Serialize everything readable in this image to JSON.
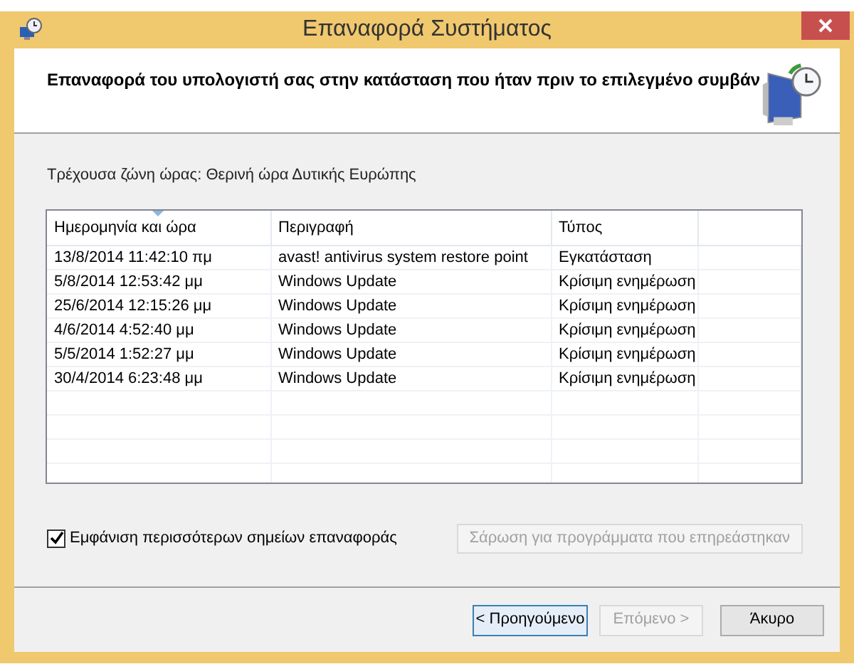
{
  "window": {
    "title": "Επαναφορά Συστήματος"
  },
  "header": {
    "text": "Επαναφορά του υπολογιστή σας στην κατάσταση που ήταν πριν το επιλεγμένο συμβάν"
  },
  "timezone": "Τρέχουσα ζώνη ώρας: Θερινή ώρα Δυτικής Ευρώπης",
  "table": {
    "columns": [
      "Ημερομηνία και ώρα",
      "Περιγραφή",
      "Τύπος"
    ],
    "rows": [
      [
        "13/8/2014 11:42:10 πμ",
        "avast! antivirus system restore point",
        "Εγκατάσταση"
      ],
      [
        "5/8/2014 12:53:42 μμ",
        "Windows Update",
        "Κρίσιμη ενημέρωση"
      ],
      [
        "25/6/2014 12:15:26 μμ",
        "Windows Update",
        "Κρίσιμη ενημέρωση"
      ],
      [
        "4/6/2014 4:52:40 μμ",
        "Windows Update",
        "Κρίσιμη ενημέρωση"
      ],
      [
        "5/5/2014 1:52:27 μμ",
        "Windows Update",
        "Κρίσιμη ενημέρωση"
      ],
      [
        "30/4/2014 6:23:48 μμ",
        "Windows Update",
        "Κρίσιμη ενημέρωση"
      ]
    ]
  },
  "show_more": {
    "label": "Εμφάνιση περισσότερων σημείων επαναφοράς",
    "checked": true
  },
  "scan_button": {
    "label": "Σάρωση για προγράμματα που επηρεάστηκαν",
    "disabled": true
  },
  "buttons": [
    {
      "label": "< Προηγούμενο",
      "disabled": false,
      "focused": true
    },
    {
      "label": "Επόμενο >",
      "disabled": true,
      "focused": false
    },
    {
      "label": "Άκυρο",
      "disabled": false,
      "focused": false
    }
  ]
}
